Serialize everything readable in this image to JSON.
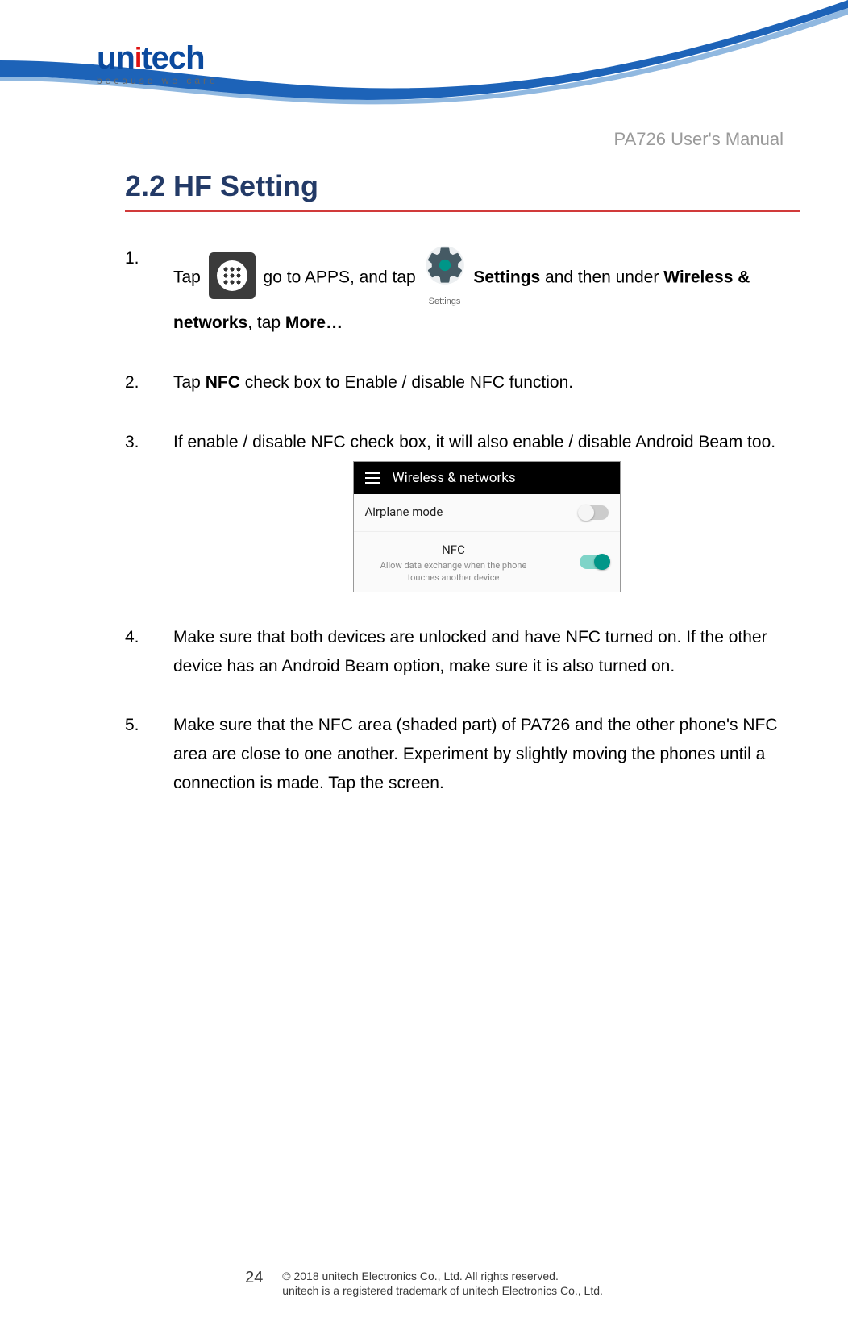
{
  "header": {
    "brand_prefix": "un",
    "brand_dot_char": "i",
    "brand_suffix": "tech",
    "tagline": "because we care",
    "doc_title": "PA726 User's Manual"
  },
  "section_title": "2.2 HF Setting",
  "step1": {
    "num": "1.",
    "a": "Tap",
    "b": " go to APPS, and tap ",
    "c": " Settings",
    "d": " and then under ",
    "e": "Wireless & networks",
    "f": ", tap ",
    "g": "More…",
    "settings_label": "Settings"
  },
  "step2": {
    "num": "2.",
    "a": "Tap ",
    "b": "NFC",
    "c": " check box to Enable / disable NFC function."
  },
  "step3": {
    "num": "3.",
    "a": "If enable / disable NFC check box, it will also enable / disable Android Beam too."
  },
  "shot": {
    "title": "Wireless & networks",
    "row1": {
      "title": "Airplane mode",
      "on": false
    },
    "row2": {
      "title": "NFC",
      "sub": "Allow data exchange when the phone touches another device",
      "on": true
    }
  },
  "step4": {
    "num": "4.",
    "a": "Make sure that both devices are unlocked and have NFC turned on. If the other device has an Android Beam option, make sure it is also turned on."
  },
  "step5": {
    "num": "5.",
    "a": "Make sure that the NFC area (shaded part) of PA726 and the other phone's NFC area are close to one another. Experiment by slightly moving the phones until a connection is made. Tap the screen."
  },
  "footer": {
    "page": "24",
    "line1": "© 2018 unitech Electronics Co., Ltd. All rights reserved.",
    "line2": "unitech is a registered trademark of unitech Electronics Co., Ltd."
  }
}
